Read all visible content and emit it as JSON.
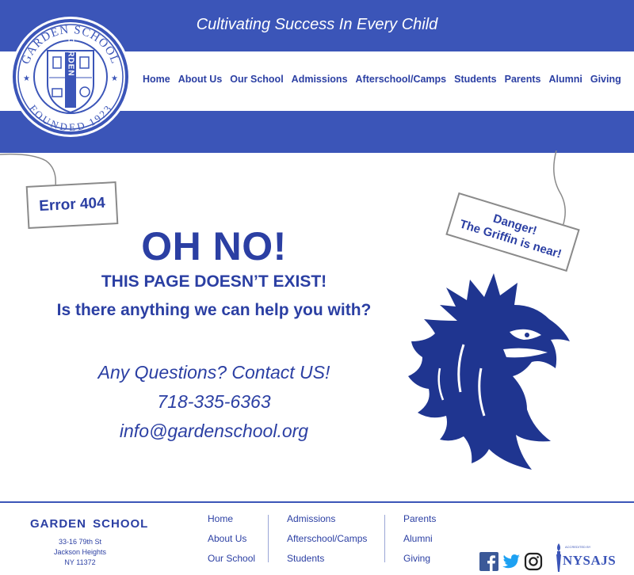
{
  "header": {
    "tagline": "Cultivating Success In Every Child",
    "logo": {
      "top_text": "GARDEN SCHOOL",
      "bottom_text": "FOUNDED 1923",
      "center_text": "GARDEN"
    },
    "nav": [
      "Home",
      "About Us",
      "Our School",
      "Admissions",
      "Afterschool/Camps",
      "Students",
      "Parents",
      "Alumni",
      "Giving"
    ]
  },
  "content": {
    "error_sign": "Error 404",
    "danger_sign": [
      "Danger!",
      "The Griffin is near!"
    ],
    "headline": "OH NO!",
    "subheadline": "THIS PAGE DOESN’T EXIST!",
    "question": "Is there anything we can help you with?",
    "contact_line": "Any Questions? Contact US!",
    "phone": "718-335-6363",
    "email": "info@gardenschool.org"
  },
  "footer": {
    "school_name": "GARDEN SCHOOL",
    "address": [
      "33-16 79th St",
      "Jackson Heights",
      "NY 11372"
    ],
    "col1": [
      "Home",
      "About Us",
      "Our School"
    ],
    "col2": [
      "Admissions",
      "Afterschool/Camps",
      "Students"
    ],
    "col3": [
      "Parents",
      "Alumni",
      "Giving"
    ],
    "social_icons": [
      "facebook-icon",
      "twitter-icon",
      "instagram-icon"
    ],
    "accreditation_logo": "NYSAJS"
  },
  "colors": {
    "brand_blue": "#3b55b8",
    "text_blue": "#2b3fa3",
    "griffin_navy": "#1f3590"
  }
}
